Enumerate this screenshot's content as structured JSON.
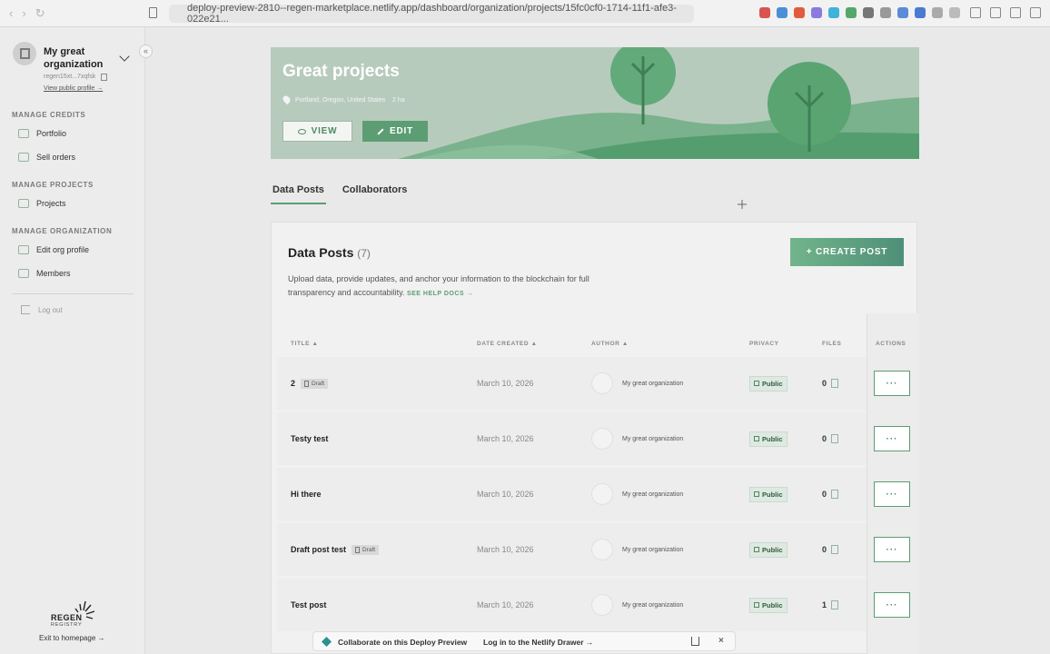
{
  "browser": {
    "url": "deploy-preview-2810--regen-marketplace.netlify.app/dashboard/organization/projects/15fc0cf0-1714-11f1-afe3-022e21..."
  },
  "sidebar": {
    "org_name": "My great organization",
    "org_address": "regen15xt...7xqfsk",
    "view_profile": "View public profile →",
    "sections": [
      {
        "title": "MANAGE CREDITS",
        "items": [
          "Portfolio",
          "Sell orders"
        ]
      },
      {
        "title": "MANAGE PROJECTS",
        "items": [
          "Projects"
        ]
      },
      {
        "title": "MANAGE ORGANIZATION",
        "items": [
          "Edit org profile",
          "Members"
        ]
      }
    ],
    "logout": "Log out",
    "logo_word": "REGEN",
    "logo_sub": "REGISTRY",
    "exit": "Exit to homepage →"
  },
  "hero": {
    "title": "Great projects",
    "location": "Portland, Oregon, United States",
    "area": "2 ha",
    "view_label": "VIEW",
    "edit_label": "EDIT"
  },
  "tabs": [
    "Data Posts",
    "Collaborators"
  ],
  "panel": {
    "title": "Data Posts",
    "count": "(7)",
    "create_label": "+ CREATE POST",
    "description": "Upload data, provide updates, and anchor your information to the blockchain for full transparency and accountability.",
    "help_link": "SEE HELP DOCS →",
    "columns": {
      "title": "TITLE",
      "date": "DATE CREATED",
      "author": "AUTHOR",
      "privacy": "PRIVACY",
      "files": "FILES",
      "actions": "ACTIONS"
    },
    "sort_arrow": "▲",
    "rows": [
      {
        "title": "2",
        "draft": "Draft",
        "date": "March 10, 2026",
        "author": "My great organization",
        "privacy": "Public",
        "files": "0"
      },
      {
        "title": "Testy test",
        "draft": "",
        "date": "March 10, 2026",
        "author": "My great organization",
        "privacy": "Public",
        "files": "0"
      },
      {
        "title": "Hi there",
        "draft": "",
        "date": "March 10, 2026",
        "author": "My great organization",
        "privacy": "Public",
        "files": "0"
      },
      {
        "title": "Draft post test",
        "draft": "Draft",
        "date": "March 10, 2026",
        "author": "My great organization",
        "privacy": "Public",
        "files": "0"
      },
      {
        "title": "Test post",
        "draft": "",
        "date": "March 10, 2026",
        "author": "My great organization",
        "privacy": "Public",
        "files": "1"
      }
    ],
    "actions_glyph": "···"
  },
  "netlify": {
    "collaborate": "Collaborate on this Deploy Preview",
    "login": "Log in to the Netlify Drawer →",
    "close_glyph": "×"
  },
  "colors": {
    "accent": "#5d9d73",
    "hero_bg": "#b7cbbd"
  }
}
